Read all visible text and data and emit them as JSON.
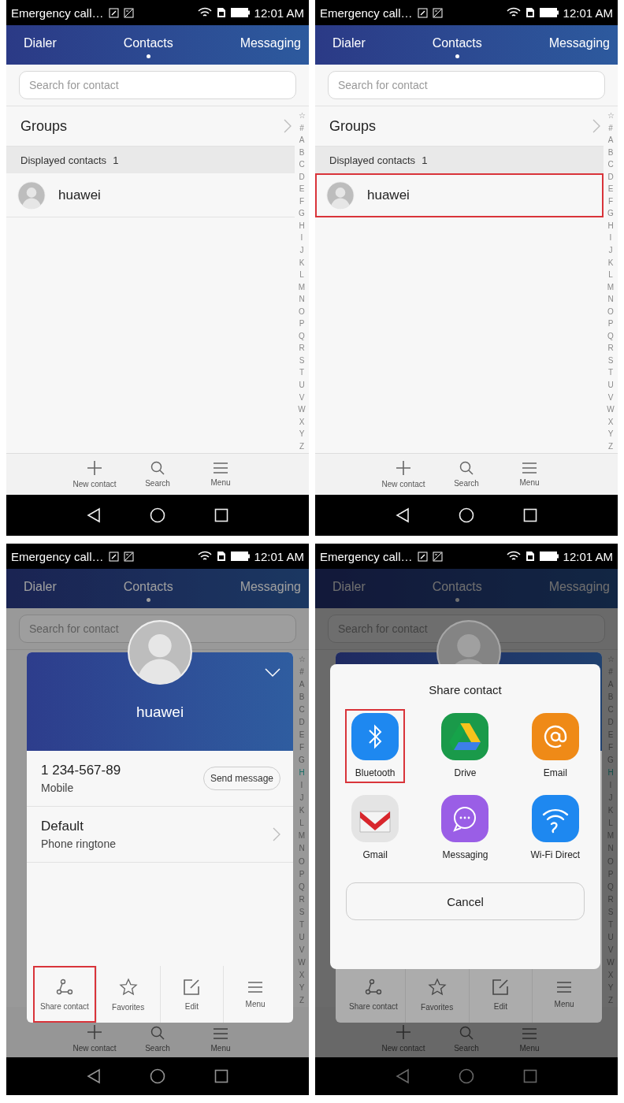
{
  "panels": [
    {
      "dimmed": false,
      "status": {
        "notice": "Emergency call…",
        "time": "12:01 AM"
      },
      "tabs": [
        {
          "label": "Dialer",
          "selected": false
        },
        {
          "label": "Contacts",
          "selected": true
        },
        {
          "label": "Messaging",
          "selected": false
        }
      ],
      "search": {
        "placeholder": "Search for contact"
      },
      "groups": "Groups",
      "section_label": "Displayed contacts",
      "section_count": "1",
      "contacts": [
        {
          "name": "huawei",
          "highlighted": false
        }
      ],
      "index": [
        {
          "label": "☆",
          "selected": false
        },
        {
          "label": "#",
          "selected": false
        },
        {
          "label": "A",
          "selected": false
        },
        {
          "label": "B",
          "selected": false
        },
        {
          "label": "C",
          "selected": false
        },
        {
          "label": "D",
          "selected": false
        },
        {
          "label": "E",
          "selected": false
        },
        {
          "label": "F",
          "selected": false
        },
        {
          "label": "G",
          "selected": false
        },
        {
          "label": "H",
          "selected": false
        },
        {
          "label": "I",
          "selected": false
        },
        {
          "label": "J",
          "selected": false
        },
        {
          "label": "K",
          "selected": false
        },
        {
          "label": "L",
          "selected": false
        },
        {
          "label": "M",
          "selected": false
        },
        {
          "label": "N",
          "selected": false
        },
        {
          "label": "O",
          "selected": false
        },
        {
          "label": "P",
          "selected": false
        },
        {
          "label": "Q",
          "selected": false
        },
        {
          "label": "R",
          "selected": false
        },
        {
          "label": "S",
          "selected": false
        },
        {
          "label": "T",
          "selected": false
        },
        {
          "label": "U",
          "selected": false
        },
        {
          "label": "V",
          "selected": false
        },
        {
          "label": "W",
          "selected": false
        },
        {
          "label": "X",
          "selected": false
        },
        {
          "label": "Y",
          "selected": false
        },
        {
          "label": "Z",
          "selected": false
        }
      ],
      "toolbar": [
        {
          "kind": "add",
          "label": "New contact"
        },
        {
          "kind": "search",
          "label": "Search"
        },
        {
          "kind": "menu",
          "label": "Menu"
        }
      ]
    },
    {
      "dimmed": false,
      "status": {
        "notice": "Emergency call…",
        "time": "12:01 AM"
      },
      "tabs": [
        {
          "label": "Dialer",
          "selected": false
        },
        {
          "label": "Contacts",
          "selected": true
        },
        {
          "label": "Messaging",
          "selected": false
        }
      ],
      "search": {
        "placeholder": "Search for contact"
      },
      "groups": "Groups",
      "section_label": "Displayed contacts",
      "section_count": "1",
      "contacts": [
        {
          "name": "huawei",
          "highlighted": true
        }
      ],
      "index": [
        {
          "label": "☆",
          "selected": false
        },
        {
          "label": "#",
          "selected": false
        },
        {
          "label": "A",
          "selected": false
        },
        {
          "label": "B",
          "selected": false
        },
        {
          "label": "C",
          "selected": false
        },
        {
          "label": "D",
          "selected": false
        },
        {
          "label": "E",
          "selected": false
        },
        {
          "label": "F",
          "selected": false
        },
        {
          "label": "G",
          "selected": false
        },
        {
          "label": "H",
          "selected": false
        },
        {
          "label": "I",
          "selected": false
        },
        {
          "label": "J",
          "selected": false
        },
        {
          "label": "K",
          "selected": false
        },
        {
          "label": "L",
          "selected": false
        },
        {
          "label": "M",
          "selected": false
        },
        {
          "label": "N",
          "selected": false
        },
        {
          "label": "O",
          "selected": false
        },
        {
          "label": "P",
          "selected": false
        },
        {
          "label": "Q",
          "selected": false
        },
        {
          "label": "R",
          "selected": false
        },
        {
          "label": "S",
          "selected": false
        },
        {
          "label": "T",
          "selected": false
        },
        {
          "label": "U",
          "selected": false
        },
        {
          "label": "V",
          "selected": false
        },
        {
          "label": "W",
          "selected": false
        },
        {
          "label": "X",
          "selected": false
        },
        {
          "label": "Y",
          "selected": false
        },
        {
          "label": "Z",
          "selected": false
        }
      ],
      "toolbar": [
        {
          "kind": "add",
          "label": "New contact"
        },
        {
          "kind": "search",
          "label": "Search"
        },
        {
          "kind": "menu",
          "label": "Menu"
        }
      ]
    },
    {
      "dimmed": true,
      "status": {
        "notice": "Emergency call…",
        "time": "12:01 AM"
      },
      "tabs": [
        {
          "label": "Dialer",
          "selected": false
        },
        {
          "label": "Contacts",
          "selected": true
        },
        {
          "label": "Messaging",
          "selected": false
        }
      ],
      "search": {
        "placeholder": "Search for contact"
      },
      "index": [
        {
          "label": "☆",
          "selected": false
        },
        {
          "label": "#",
          "selected": false
        },
        {
          "label": "A",
          "selected": false
        },
        {
          "label": "B",
          "selected": false
        },
        {
          "label": "C",
          "selected": false
        },
        {
          "label": "D",
          "selected": false
        },
        {
          "label": "E",
          "selected": false
        },
        {
          "label": "F",
          "selected": false
        },
        {
          "label": "G",
          "selected": false
        },
        {
          "label": "H",
          "selected": true
        },
        {
          "label": "I",
          "selected": false
        },
        {
          "label": "J",
          "selected": false
        },
        {
          "label": "K",
          "selected": false
        },
        {
          "label": "L",
          "selected": false
        },
        {
          "label": "M",
          "selected": false
        },
        {
          "label": "N",
          "selected": false
        },
        {
          "label": "O",
          "selected": false
        },
        {
          "label": "P",
          "selected": false
        },
        {
          "label": "Q",
          "selected": false
        },
        {
          "label": "R",
          "selected": false
        },
        {
          "label": "S",
          "selected": false
        },
        {
          "label": "T",
          "selected": false
        },
        {
          "label": "U",
          "selected": false
        },
        {
          "label": "V",
          "selected": false
        },
        {
          "label": "W",
          "selected": false
        },
        {
          "label": "X",
          "selected": false
        },
        {
          "label": "Y",
          "selected": false
        },
        {
          "label": "Z",
          "selected": false
        }
      ],
      "toolbar": [
        {
          "kind": "add",
          "label": "New contact"
        },
        {
          "kind": "search",
          "label": "Search"
        },
        {
          "kind": "menu",
          "label": "Menu"
        }
      ],
      "card": {
        "name": "huawei",
        "phone": "1 234-567-89",
        "phone_type": "Mobile",
        "send_button": "Send message",
        "ringtone": "Default",
        "ringtone_label": "Phone ringtone",
        "actions": [
          {
            "kind": "share",
            "label": "Share contact",
            "highlighted": true
          },
          {
            "kind": "star",
            "label": "Favorites",
            "highlighted": false
          },
          {
            "kind": "edit",
            "label": "Edit",
            "highlighted": false
          },
          {
            "kind": "menu",
            "label": "Menu",
            "highlighted": false
          }
        ]
      }
    },
    {
      "dimmed": true,
      "status": {
        "notice": "Emergency call…",
        "time": "12:01 AM"
      },
      "tabs": [
        {
          "label": "Dialer",
          "selected": false
        },
        {
          "label": "Contacts",
          "selected": true
        },
        {
          "label": "Messaging",
          "selected": false
        }
      ],
      "search": {
        "placeholder": "Search for contact"
      },
      "index": [
        {
          "label": "☆",
          "selected": false
        },
        {
          "label": "#",
          "selected": false
        },
        {
          "label": "A",
          "selected": false
        },
        {
          "label": "B",
          "selected": false
        },
        {
          "label": "C",
          "selected": false
        },
        {
          "label": "D",
          "selected": false
        },
        {
          "label": "E",
          "selected": false
        },
        {
          "label": "F",
          "selected": false
        },
        {
          "label": "G",
          "selected": false
        },
        {
          "label": "H",
          "selected": true
        },
        {
          "label": "I",
          "selected": false
        },
        {
          "label": "J",
          "selected": false
        },
        {
          "label": "K",
          "selected": false
        },
        {
          "label": "L",
          "selected": false
        },
        {
          "label": "M",
          "selected": false
        },
        {
          "label": "N",
          "selected": false
        },
        {
          "label": "O",
          "selected": false
        },
        {
          "label": "P",
          "selected": false
        },
        {
          "label": "Q",
          "selected": false
        },
        {
          "label": "R",
          "selected": false
        },
        {
          "label": "S",
          "selected": false
        },
        {
          "label": "T",
          "selected": false
        },
        {
          "label": "U",
          "selected": false
        },
        {
          "label": "V",
          "selected": false
        },
        {
          "label": "W",
          "selected": false
        },
        {
          "label": "X",
          "selected": false
        },
        {
          "label": "Y",
          "selected": false
        },
        {
          "label": "Z",
          "selected": false
        }
      ],
      "toolbar": [
        {
          "kind": "add",
          "label": "New contact"
        },
        {
          "kind": "search",
          "label": "Search"
        },
        {
          "kind": "menu",
          "label": "Menu"
        }
      ],
      "card": {
        "actions": [
          {
            "kind": "share",
            "label": "Share contact",
            "highlighted": false
          },
          {
            "kind": "star",
            "label": "Favorites",
            "highlighted": false
          },
          {
            "kind": "edit",
            "label": "Edit",
            "highlighted": false
          },
          {
            "kind": "menu",
            "label": "Menu",
            "highlighted": false
          }
        ]
      },
      "share_dialog": {
        "title": "Share contact",
        "cancel": "Cancel",
        "apps": [
          {
            "kind": "bluetooth",
            "label": "Bluetooth",
            "highlighted": true
          },
          {
            "kind": "drive",
            "label": "Drive",
            "highlighted": false
          },
          {
            "kind": "email",
            "label": "Email",
            "highlighted": false
          },
          {
            "kind": "gmail",
            "label": "Gmail",
            "highlighted": false
          },
          {
            "kind": "messaging",
            "label": "Messaging",
            "highlighted": false
          },
          {
            "kind": "wifi_direct",
            "label": "Wi-Fi Direct",
            "highlighted": false
          }
        ]
      }
    }
  ]
}
